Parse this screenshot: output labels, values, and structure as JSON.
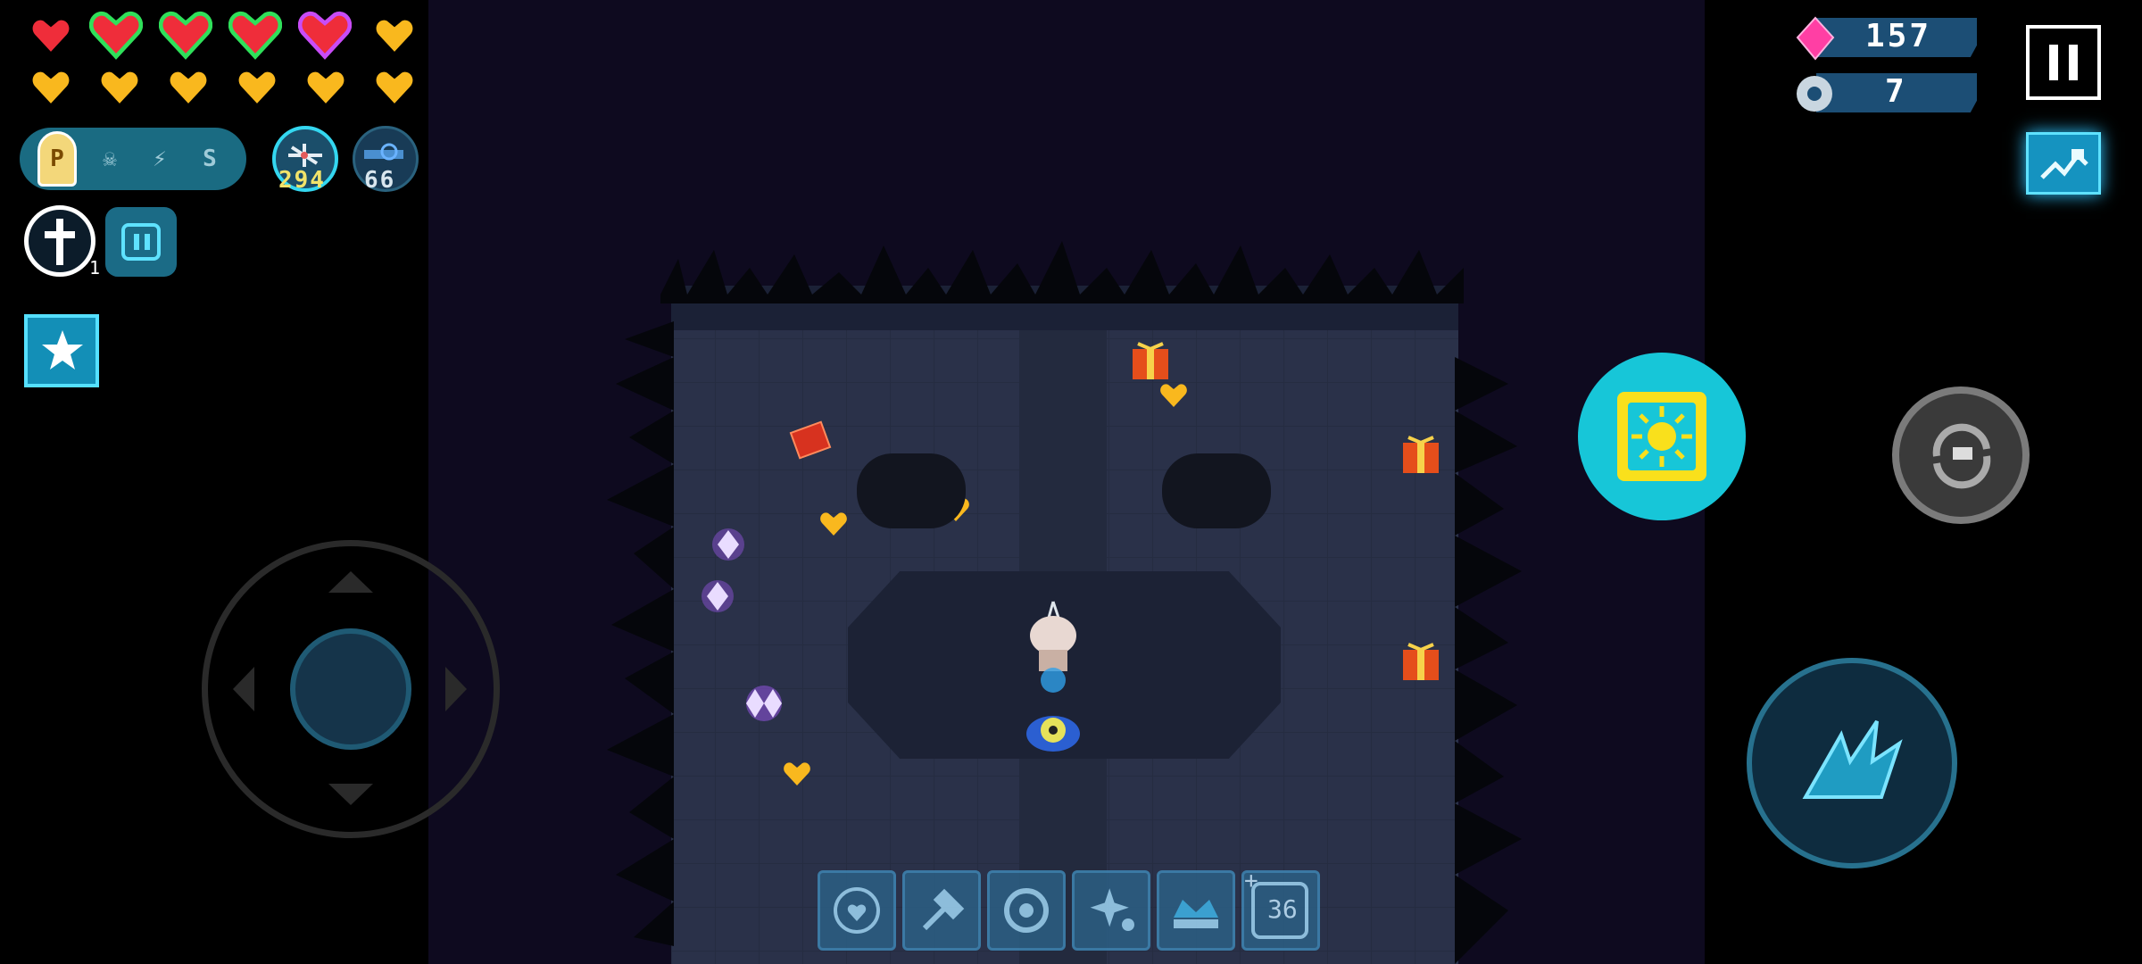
{
  "hud": {
    "gems": {
      "value": "157",
      "icon": "pink-gem-icon",
      "color": "#ff3fa4"
    },
    "parts": {
      "value": "7",
      "icon": "gear-part-icon"
    },
    "buffs": [
      "P",
      "skull",
      "lightning",
      "S"
    ],
    "weapon_primary": {
      "ammo": "294",
      "icon": "crossbow-weapon-icon",
      "ammo_color": "#f2e36a"
    },
    "weapon_secondary": {
      "ammo": "66",
      "icon": "blaster-weapon-icon",
      "ammo_color": "#d9e6ee"
    },
    "cross_item": {
      "count": "1",
      "icon": "cross-icon"
    },
    "hotbar": [
      {
        "icon": "heart-shield-icon"
      },
      {
        "icon": "hammer-icon"
      },
      {
        "icon": "gear-ring-icon"
      },
      {
        "icon": "sparkle-icon"
      },
      {
        "icon": "crown-fountain-icon"
      },
      {
        "icon": "counter-icon",
        "label": "36"
      }
    ]
  },
  "health": {
    "red": 1,
    "green_outlined": 3,
    "purple_outlined": 1,
    "gold": 7,
    "colors": {
      "red": "#ef2d3a",
      "green": "#2fe05a",
      "purple": "#c94cf7",
      "gold": "#f9b81e"
    }
  },
  "controls": {
    "skill": "sun-skill-icon",
    "swap": "weapon-swap-icon",
    "attack": "claw-attack-icon",
    "map": "minimap-icon",
    "pause": "pause-icon"
  }
}
